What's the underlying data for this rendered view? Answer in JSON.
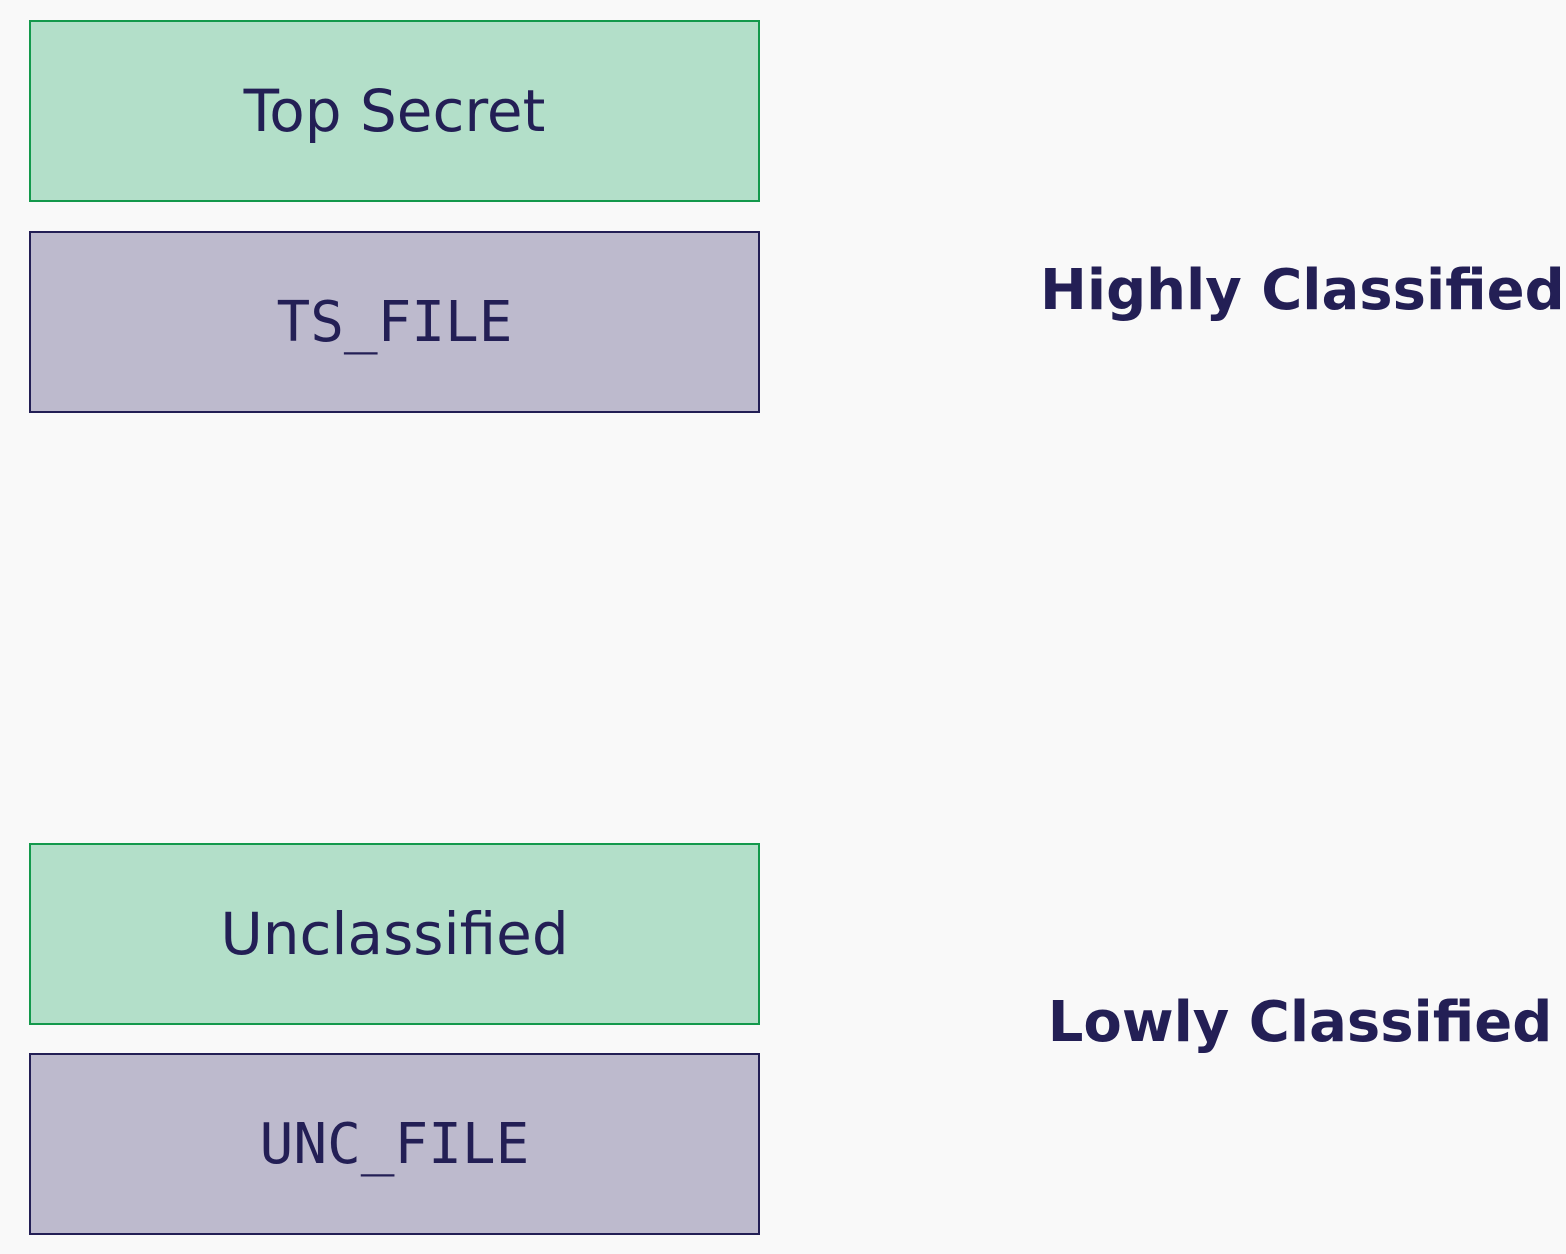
{
  "colors": {
    "background": "#f9f9f9",
    "level_fill": "#b3dfc9",
    "level_border": "#13994c",
    "file_fill": "#bdbacd",
    "file_border": "#231f55",
    "text": "#231f55"
  },
  "high": {
    "level_label": "Top Secret",
    "file_label": "TS_FILE",
    "tier_label": "Highly Classified"
  },
  "low": {
    "level_label": "Unclassified",
    "file_label": "UNC_FILE",
    "tier_label": "Lowly Classified"
  }
}
